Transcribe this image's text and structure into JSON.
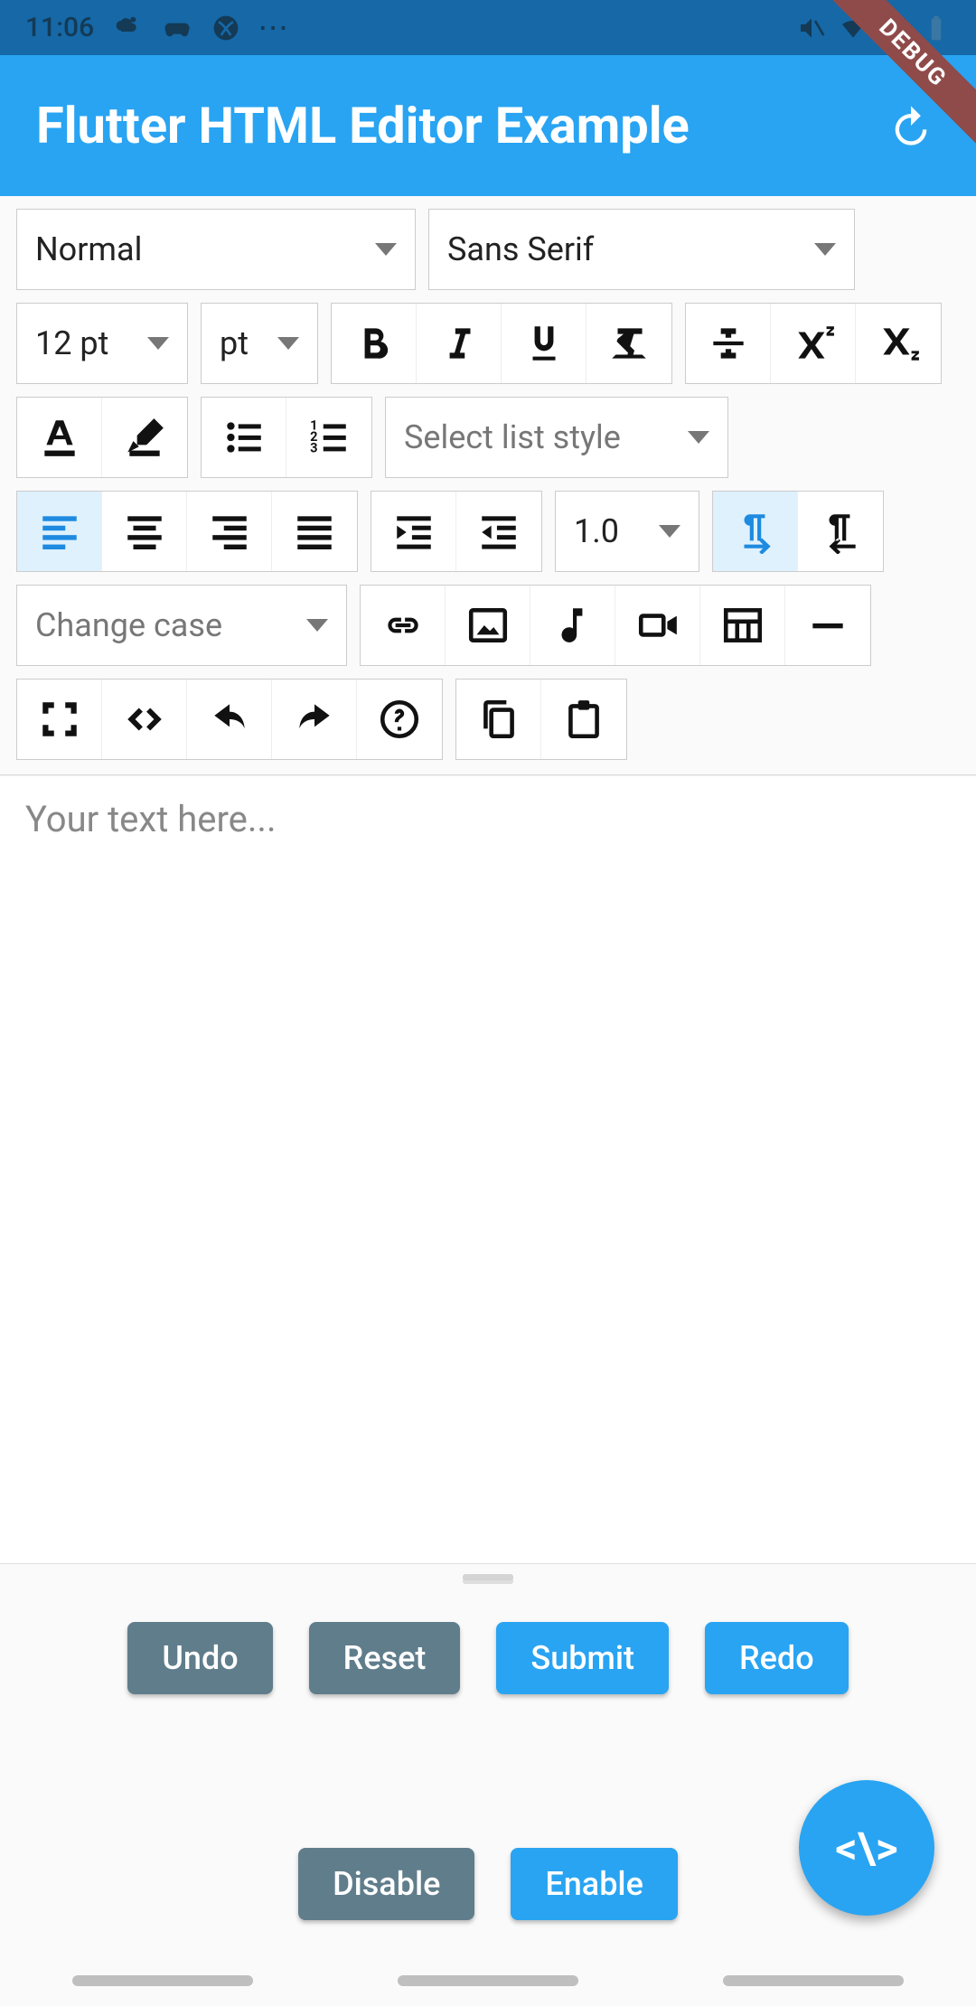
{
  "status": {
    "time": "11:06"
  },
  "header": {
    "title": "Flutter HTML Editor Example",
    "debug": "DEBUG"
  },
  "toolbar": {
    "paragraph_style": "Normal",
    "font_family": "Sans Serif",
    "font_size": "12 pt",
    "font_unit": "pt",
    "list_style_placeholder": "Select list style",
    "line_height": "1.0",
    "change_case": "Change case"
  },
  "editor": {
    "placeholder": "Your text here..."
  },
  "buttons": {
    "undo": "Undo",
    "reset": "Reset",
    "submit": "Submit",
    "redo": "Redo",
    "disable": "Disable",
    "enable": "Enable"
  },
  "fab": {
    "label": "<\\>"
  }
}
